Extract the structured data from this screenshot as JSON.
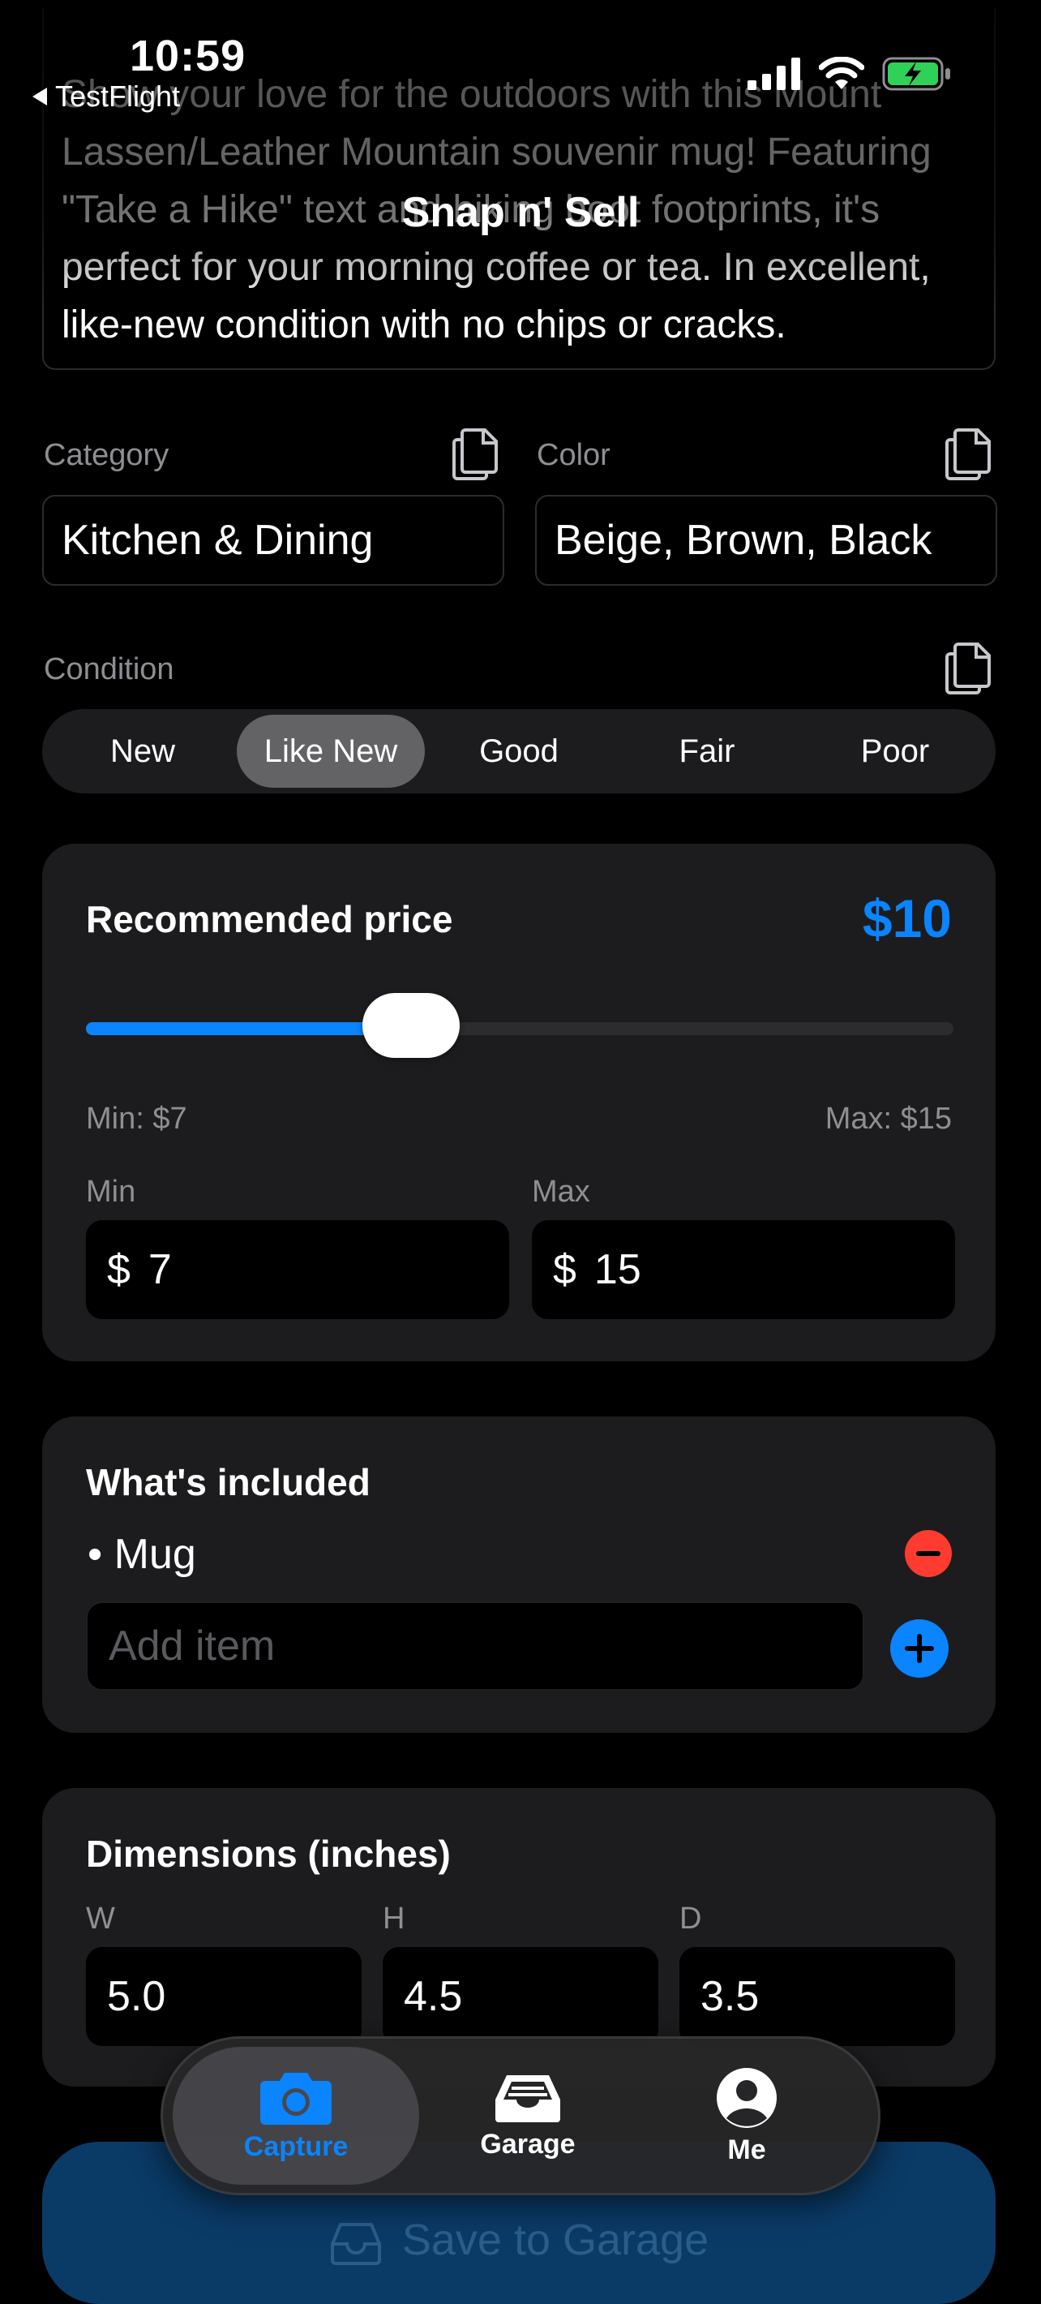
{
  "status": {
    "time": "10:59",
    "back_app": "TestFlight"
  },
  "nav": {
    "title": "Snap n' Sell"
  },
  "description": {
    "text": "Show your love for the outdoors with this Mount Lassen/Leather Mountain souvenir mug! Featuring \"Take a Hike\" text and hiking boot footprints, it's perfect for your morning coffee or tea. In excellent, like-new condition with no chips or cracks."
  },
  "category": {
    "label": "Category",
    "value": "Kitchen & Dining"
  },
  "color": {
    "label": "Color",
    "value": "Beige, Brown, Black"
  },
  "condition": {
    "label": "Condition",
    "options": [
      "New",
      "Like New",
      "Good",
      "Fair",
      "Poor"
    ],
    "selected": "Like New"
  },
  "price": {
    "title": "Recommended price",
    "value": "$10",
    "slider_fraction": 0.375,
    "min_text": "Min: $7",
    "max_text": "Max: $15",
    "min_label": "Min",
    "max_label": "Max",
    "currency": "$",
    "min_value": "7",
    "max_value": "15"
  },
  "included": {
    "title": "What's included",
    "items": [
      "• Mug"
    ],
    "add_placeholder": "Add item"
  },
  "dimensions": {
    "title": "Dimensions (inches)",
    "w_label": "W",
    "h_label": "H",
    "d_label": "D",
    "w": "5.0",
    "h": "4.5",
    "d": "3.5"
  },
  "tabs": [
    {
      "label": "Capture",
      "icon": "camera-icon",
      "active": true
    },
    {
      "label": "Garage",
      "icon": "tray-icon",
      "active": false
    },
    {
      "label": "Me",
      "icon": "person-icon",
      "active": false
    }
  ],
  "save_button": {
    "label": "Save to Garage"
  },
  "colors": {
    "accent": "#0a84ff",
    "destructive": "#ff3b30",
    "card": "#1c1c1e"
  }
}
